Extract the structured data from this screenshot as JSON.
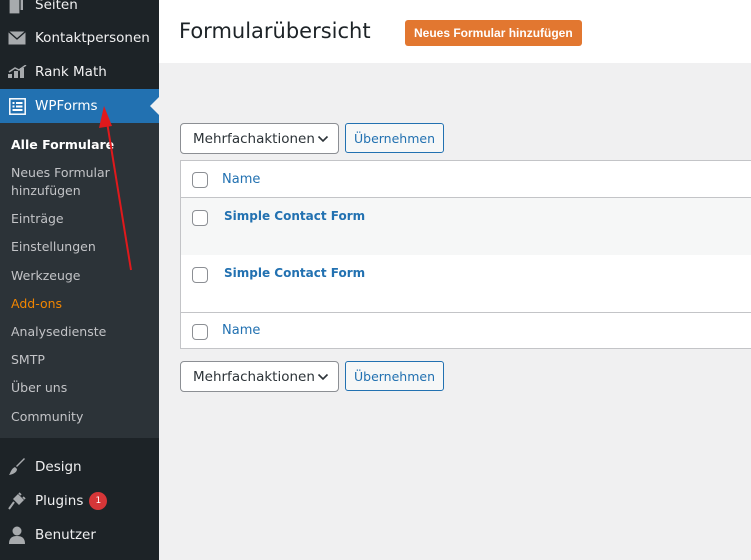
{
  "sidebar": {
    "items": [
      {
        "label": "Seiten",
        "icon": "pages-icon"
      },
      {
        "label": "Kontaktpersonen",
        "icon": "mail-icon"
      },
      {
        "label": "Rank Math",
        "icon": "rank-math-icon"
      },
      {
        "label": "WPForms",
        "icon": "wpforms-icon",
        "active": true
      }
    ],
    "submenu": [
      {
        "label": "Alle Formulare"
      },
      {
        "label": "Neues Formular hinzufügen"
      },
      {
        "label": "Einträge"
      },
      {
        "label": "Einstellungen"
      },
      {
        "label": "Werkzeuge"
      },
      {
        "label": "Add-ons"
      },
      {
        "label": "Analysedienste"
      },
      {
        "label": "SMTP"
      },
      {
        "label": "Über uns"
      },
      {
        "label": "Community"
      }
    ],
    "bottom_items": [
      {
        "label": "Design",
        "icon": "brush-icon"
      },
      {
        "label": "Plugins",
        "icon": "plugin-icon",
        "badge": "1"
      },
      {
        "label": "Benutzer",
        "icon": "user-icon"
      }
    ]
  },
  "header": {
    "title": "Formularübersicht",
    "add_button": "Neues Formular hinzufügen"
  },
  "bulk": {
    "select_label": "Mehrfachaktionen",
    "apply_label": "Übernehmen"
  },
  "table": {
    "column_name": "Name",
    "rows": [
      {
        "name": "Simple Contact Form"
      },
      {
        "name": "Simple Contact Form"
      }
    ]
  },
  "colors": {
    "sidebar_bg": "#1d2327",
    "submenu_bg": "#2c3338",
    "active_bg": "#2271b1",
    "accent_orange": "#e27730",
    "link_blue": "#2271b1",
    "annotation_red": "#e0191c"
  }
}
